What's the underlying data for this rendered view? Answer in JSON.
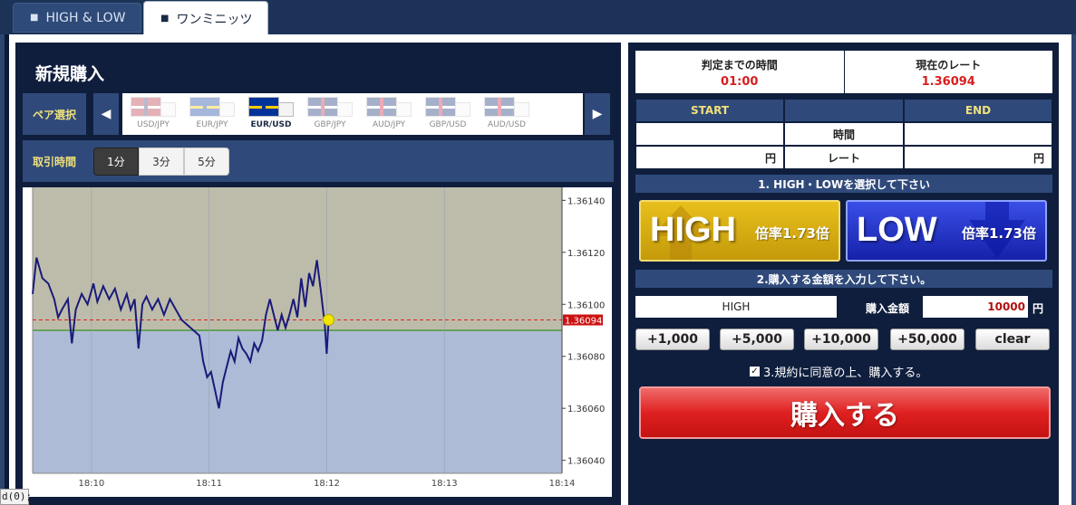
{
  "tabs": [
    {
      "label": "HIGH & LOW",
      "active": false
    },
    {
      "label": "ワンミニッツ",
      "active": true
    }
  ],
  "left": {
    "title": "新規購入",
    "pair_label": "ペア選択",
    "pairs": [
      {
        "code": "USD/JPY",
        "flag": "us-flag"
      },
      {
        "code": "EUR/JPY",
        "flag": "eu-flag"
      },
      {
        "code": "EUR/USD",
        "flag": "eu-flag",
        "active": true
      },
      {
        "code": "GBP/JPY",
        "flag": "uk-flag"
      },
      {
        "code": "AUD/JPY",
        "flag": "au-flag"
      },
      {
        "code": "GBP/USD",
        "flag": "uk-flag"
      },
      {
        "code": "AUD/USD",
        "flag": "au-flag"
      }
    ],
    "time_label": "取引時間",
    "time_options": [
      "1分",
      "3分",
      "5分"
    ],
    "time_selected": "1分"
  },
  "chart_data": {
    "type": "line",
    "title": "",
    "xlabel": "",
    "ylabel": "",
    "x_ticks": [
      "18:10",
      "18:11",
      "18:12",
      "18:13",
      "18:14"
    ],
    "y_ticks": [
      "1.36140",
      "1.36120",
      "1.36100",
      "1.36080",
      "1.36060",
      "1.36040"
    ],
    "ylim": [
      1.36035,
      1.36145
    ],
    "xlim": [
      "18:09:30",
      "18:14:00"
    ],
    "current_rate_label": "1.36094",
    "current_rate": 1.36094,
    "strike_level": 1.3609,
    "series": [
      {
        "values": [
          [
            "18:09:30",
            1.36104
          ],
          [
            "18:09:32",
            1.36118
          ],
          [
            "18:09:35",
            1.3611
          ],
          [
            "18:09:38",
            1.36108
          ],
          [
            "18:09:41",
            1.36102
          ],
          [
            "18:09:43",
            1.36095
          ],
          [
            "18:09:45",
            1.36098
          ],
          [
            "18:09:48",
            1.36102
          ],
          [
            "18:09:50",
            1.36085
          ],
          [
            "18:09:52",
            1.36098
          ],
          [
            "18:09:55",
            1.36104
          ],
          [
            "18:09:58",
            1.361
          ],
          [
            "18:10:01",
            1.36108
          ],
          [
            "18:10:03",
            1.36101
          ],
          [
            "18:10:06",
            1.36107
          ],
          [
            "18:10:09",
            1.36102
          ],
          [
            "18:10:12",
            1.36106
          ],
          [
            "18:10:15",
            1.36098
          ],
          [
            "18:10:18",
            1.36104
          ],
          [
            "18:10:20",
            1.36098
          ],
          [
            "18:10:22",
            1.36102
          ],
          [
            "18:10:24",
            1.36083
          ],
          [
            "18:10:26",
            1.361
          ],
          [
            "18:10:28",
            1.36103
          ],
          [
            "18:10:31",
            1.36098
          ],
          [
            "18:10:34",
            1.36102
          ],
          [
            "18:10:37",
            1.36096
          ],
          [
            "18:10:40",
            1.36102
          ],
          [
            "18:10:43",
            1.36098
          ],
          [
            "18:10:46",
            1.36094
          ],
          [
            "18:10:49",
            1.36092
          ],
          [
            "18:10:52",
            1.3609
          ],
          [
            "18:10:55",
            1.36088
          ],
          [
            "18:10:57",
            1.36078
          ],
          [
            "18:10:59",
            1.36072
          ],
          [
            "18:11:01",
            1.36074
          ],
          [
            "18:11:03",
            1.36067
          ],
          [
            "18:11:05",
            1.3606
          ],
          [
            "18:11:07",
            1.3607
          ],
          [
            "18:11:09",
            1.36076
          ],
          [
            "18:11:11",
            1.36082
          ],
          [
            "18:11:13",
            1.36078
          ],
          [
            "18:11:15",
            1.36087
          ],
          [
            "18:11:17",
            1.36083
          ],
          [
            "18:11:19",
            1.36081
          ],
          [
            "18:11:21",
            1.36078
          ],
          [
            "18:11:23",
            1.36085
          ],
          [
            "18:11:25",
            1.36082
          ],
          [
            "18:11:27",
            1.36086
          ],
          [
            "18:11:29",
            1.36096
          ],
          [
            "18:11:31",
            1.36102
          ],
          [
            "18:11:33",
            1.36096
          ],
          [
            "18:11:35",
            1.3609
          ],
          [
            "18:11:37",
            1.36096
          ],
          [
            "18:11:39",
            1.36091
          ],
          [
            "18:11:41",
            1.36096
          ],
          [
            "18:11:43",
            1.36102
          ],
          [
            "18:11:45",
            1.36095
          ],
          [
            "18:11:47",
            1.3611
          ],
          [
            "18:11:49",
            1.36099
          ],
          [
            "18:11:51",
            1.36112
          ],
          [
            "18:11:53",
            1.36107
          ],
          [
            "18:11:55",
            1.36117
          ],
          [
            "18:11:57",
            1.36105
          ],
          [
            "18:11:59",
            1.36092
          ],
          [
            "18:12:00",
            1.36081
          ],
          [
            "18:12:01",
            1.36094
          ]
        ]
      }
    ]
  },
  "right": {
    "time_to_judge_label": "判定までの時間",
    "time_to_judge": "01:00",
    "current_rate_label": "現在のレート",
    "current_rate": "1.36094",
    "start_label": "START",
    "end_label": "END",
    "time_row_label": "時間",
    "rate_row_label": "レート",
    "yen": "円",
    "step1": "1. HIGH・LOWを選択して下さい",
    "high_label": "HIGH",
    "low_label": "LOW",
    "high_payout": "倍率1.73倍",
    "low_payout": "倍率1.73倍",
    "step2": "2.購入する金額を入力して下さい。",
    "selected_direction": "HIGH",
    "amount_label": "購入金額",
    "amount": "10000",
    "add_buttons": [
      "+1,000",
      "+5,000",
      "+10,000",
      "+50,000",
      "clear"
    ],
    "agree_text": "3.規約に同意の上、購入する。",
    "agree_checked": true,
    "buy_label": "購入する"
  },
  "status_text": "d(0);"
}
